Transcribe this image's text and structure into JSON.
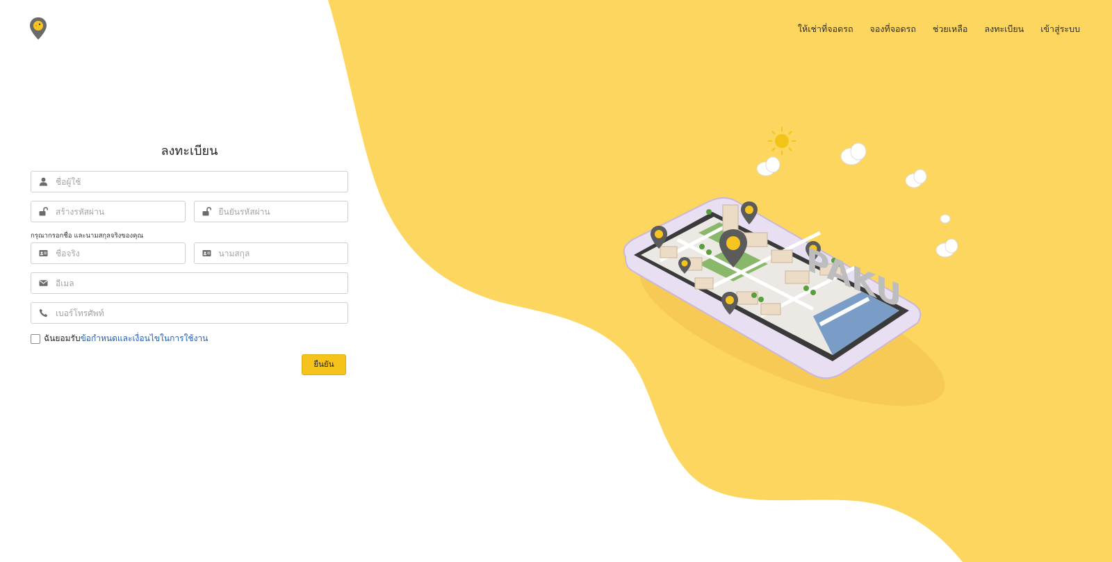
{
  "nav": {
    "items": [
      "ให้เช่าที่จอดรถ",
      "จองที่จอดรถ",
      "ช่วยเหลือ",
      "ลงทะเบียน",
      "เข้าสู่ระบบ"
    ]
  },
  "form": {
    "title": "ลงทะเบียน",
    "username_placeholder": "ชื่อผู้ใช้",
    "password_placeholder": "สร้างรหัสผ่าน",
    "confirm_password_placeholder": "ยืนยันรหัสผ่าน",
    "name_hint": "กรุณากรอกชื่อ และนามสกุลจริงของคุณ",
    "first_name_placeholder": "ชื่อจริง",
    "last_name_placeholder": "นามสกุล",
    "email_placeholder": "อีเมล",
    "phone_placeholder": "เบอร์โทรศัพท์",
    "terms_prefix": "ฉันยอมรับ",
    "terms_link": "ข้อกำหนดและเงื่อนไขในการใช้งาน",
    "submit_label": "ยืนยัน"
  },
  "illustration": {
    "label": "PAKU"
  },
  "colors": {
    "accent_yellow": "#FDD660",
    "button_yellow": "#F5C31C",
    "link_blue": "#2461B0",
    "icon_gray": "#6B6B6B"
  }
}
